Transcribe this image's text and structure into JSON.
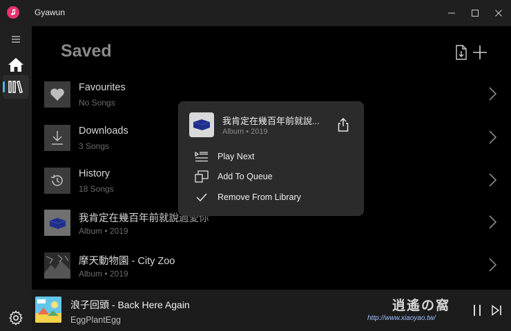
{
  "window": {
    "title": "Gyawun",
    "controls": [
      "minimize-icon",
      "maximize-icon",
      "close-icon"
    ]
  },
  "nav": {
    "items": [
      {
        "name": "menu-icon"
      },
      {
        "name": "home-icon"
      },
      {
        "name": "library-icon",
        "active": true
      }
    ],
    "settings_icon": "gear-icon",
    "accent": "#4fb3e8"
  },
  "page": {
    "title": "Saved",
    "actions": [
      "import-file-icon",
      "add-icon"
    ]
  },
  "library": {
    "items": [
      {
        "title": "Favourites",
        "subtitle": "No Songs",
        "icon": "heart-icon"
      },
      {
        "title": "Downloads",
        "subtitle": "3 Songs",
        "icon": "download-icon"
      },
      {
        "title": "History",
        "subtitle": "18 Songs",
        "icon": "history-icon"
      },
      {
        "title": "我肯定在幾百年前就說過愛你",
        "subtitle": "Album • 2019",
        "icon": "album-cover"
      },
      {
        "title": "摩天動物園 - City Zoo",
        "subtitle": "Album • 2019",
        "icon": "album-cover"
      }
    ]
  },
  "context_menu": {
    "title": "我肯定在幾百年前就說...",
    "subtitle": "Album • 2019",
    "share_icon": "share-icon",
    "items": [
      {
        "label": "Play Next",
        "icon": "play-next-icon"
      },
      {
        "label": "Add To Queue",
        "icon": "add-to-queue-icon"
      },
      {
        "label": "Remove From Library",
        "icon": "check-icon"
      }
    ]
  },
  "player": {
    "title": "浪子回頭 - Back Here Again",
    "artist": "EggPlantEgg",
    "controls": [
      "pause-icon",
      "skip-next-icon"
    ]
  },
  "watermark": {
    "text": "逍遙の窩",
    "url": "http://www.xiaoyao.tw/"
  }
}
